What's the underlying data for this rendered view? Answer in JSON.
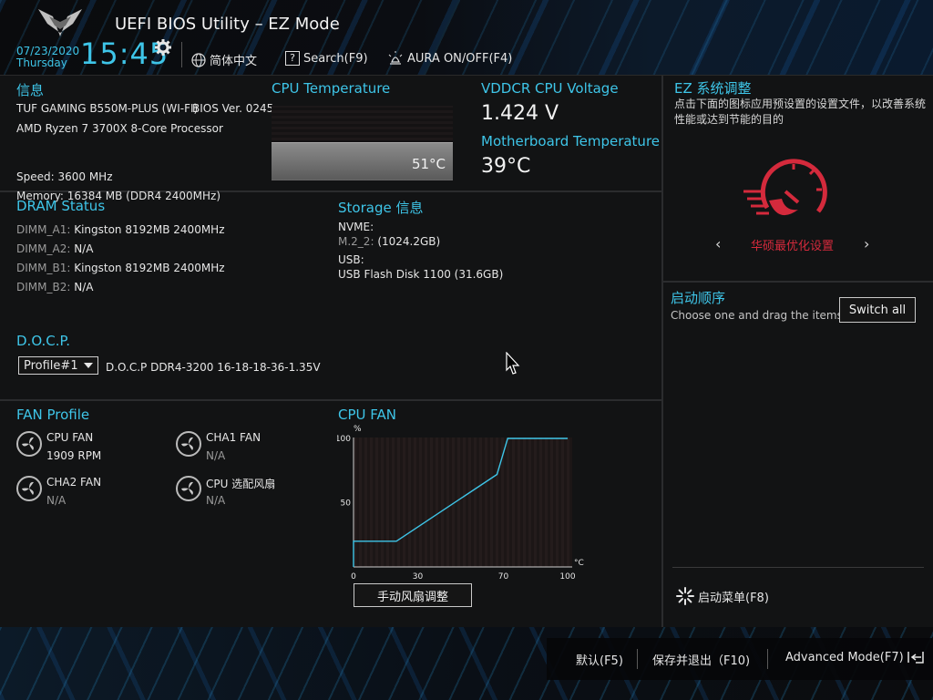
{
  "header": {
    "title": "UEFI BIOS Utility – EZ Mode",
    "date": "07/23/2020",
    "day": "Thursday",
    "time": "15:45",
    "language": "简体中文",
    "search": "Search(F9)",
    "aura": "AURA ON/OFF(F4)"
  },
  "info": {
    "title": "信息",
    "board": "TUF GAMING B550M-PLUS (WI-FI)",
    "bios": "BIOS Ver. 0245",
    "cpu": "AMD Ryzen 7 3700X 8-Core Processor",
    "speed": "Speed: 3600 MHz",
    "memory": "Memory: 16384 MB (DDR4 2400MHz)"
  },
  "cpu_temp": {
    "title": "CPU Temperature",
    "value": "51°C"
  },
  "voltage": {
    "title": "VDDCR CPU Voltage",
    "value": "1.424 V"
  },
  "mb_temp": {
    "title": "Motherboard Temperature",
    "value": "39°C"
  },
  "dram": {
    "title": "DRAM Status",
    "slots": [
      {
        "name": "DIMM_A1:",
        "value": "Kingston 8192MB 2400MHz"
      },
      {
        "name": "DIMM_A2:",
        "value": "N/A"
      },
      {
        "name": "DIMM_B1:",
        "value": "Kingston 8192MB 2400MHz"
      },
      {
        "name": "DIMM_B2:",
        "value": "N/A"
      }
    ]
  },
  "storage": {
    "title": "Storage 信息",
    "nvme_label": "NVME:",
    "nvme_slot": "M.2_2:",
    "nvme_value": "(1024.2GB)",
    "usb_label": "USB:",
    "usb_value": "USB Flash Disk 1100 (31.6GB)"
  },
  "docp": {
    "title": "D.O.C.P.",
    "selected": "Profile#1",
    "desc": "D.O.C.P DDR4-3200 16-18-18-36-1.35V"
  },
  "fan_profile": {
    "title": "FAN Profile",
    "fans": [
      {
        "name": "CPU FAN",
        "value": "1909 RPM"
      },
      {
        "name": "CHA1 FAN",
        "value": "N/A"
      },
      {
        "name": "CHA2 FAN",
        "value": "N/A"
      },
      {
        "name": "CPU 选配风扇",
        "value": "N/A"
      }
    ]
  },
  "cpu_fan": {
    "title": "CPU FAN",
    "manual_button": "手动风扇调整"
  },
  "chart_data": {
    "type": "line",
    "title": "CPU FAN",
    "xlabel": "°C",
    "ylabel": "%",
    "xlim": [
      0,
      100
    ],
    "ylim": [
      0,
      100
    ],
    "xticks": [
      "0",
      "30",
      "70",
      "100"
    ],
    "yticks": [
      "50",
      "100"
    ],
    "grid": false,
    "series": [
      {
        "x": [
          0,
          0,
          20,
          67,
          72,
          100
        ],
        "y": [
          0,
          20,
          20,
          72,
          100,
          100
        ]
      }
    ]
  },
  "ez_tuning": {
    "title": "EZ 系统调整",
    "desc": "点击下面的图标应用预设置的设置文件，以改善系统性能或达到节能的目的",
    "mode": "华硕最优化设置"
  },
  "boot": {
    "title": "启动顺序",
    "hint": "Choose one and drag the items.",
    "switch_all": "Switch all",
    "menu": "启动菜单(F8)"
  },
  "footer": {
    "default": "默认(F5)",
    "save_exit": "保存并退出（F10)",
    "advanced": "Advanced Mode(F7)"
  },
  "colors": {
    "accent": "#3ec5e8",
    "ez_red": "#d42a3c"
  }
}
